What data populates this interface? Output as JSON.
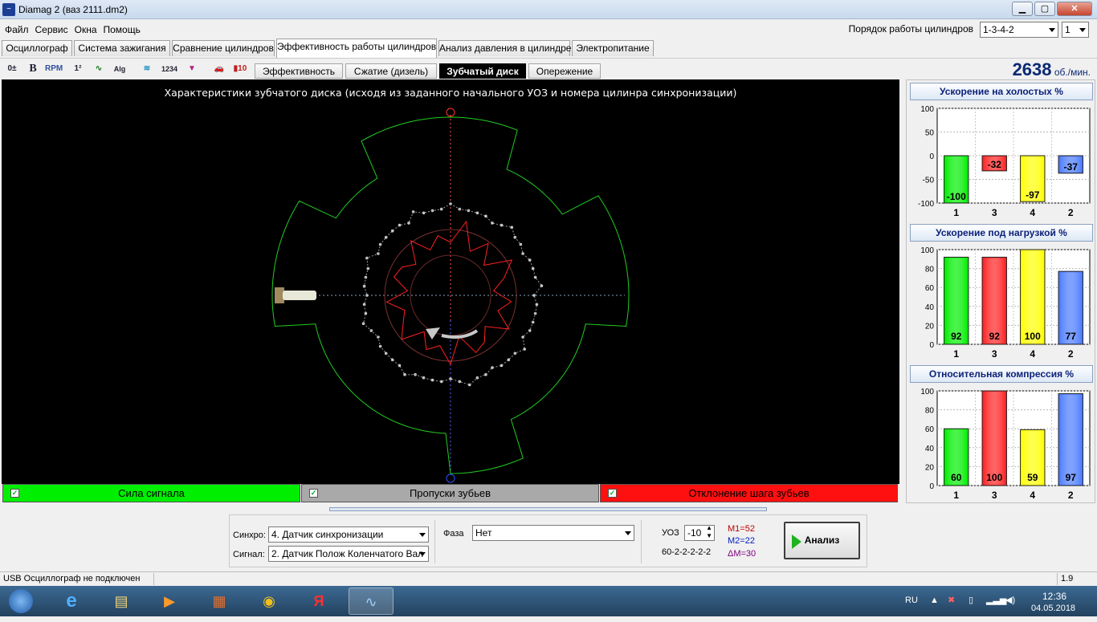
{
  "window": {
    "title": "Diamag 2 (ваз 2111.dm2)",
    "minimize": "▁",
    "maximize": "▢",
    "close": "✕"
  },
  "menu": [
    "Файл",
    "Сервис",
    "Окна",
    "Помощь"
  ],
  "cyl_order": {
    "label": "Порядок работы цилиндров",
    "value": "1-3-4-2",
    "cyl_number": "1"
  },
  "tabs": [
    "Осциллограф",
    "Система зажигания",
    "Сравнение цилиндров",
    "Эффективность работы цилиндров",
    "Анализ давления в цилиндре",
    "Электропитание"
  ],
  "active_tab": "Эффективность работы цилиндров",
  "toolbar_icons": [
    "zero-trim-icon",
    "bold-icon",
    "rpm-icon",
    "sort-icon",
    "trend-icon",
    "algorithm-icon",
    "sensor-icon",
    "counter-icon",
    "filter-icon",
    "car-icon",
    "bar-10-icon"
  ],
  "subtabs": [
    "Эффективность",
    "Сжатие (дизель)",
    "Зубчатый диск",
    "Опережение"
  ],
  "active_subtab": "Зубчатый диск",
  "rpm": {
    "value": "2638",
    "unit": "об./мин."
  },
  "plot": {
    "title": "Характеристики зубчатого диска (исходя из заданного начального УОЗ и номера цилинра синхронизации)"
  },
  "legend": [
    {
      "label": "Сила сигнала",
      "color": "#00ee00"
    },
    {
      "label": "Пропуски зубьев",
      "color": "#a9a9a9"
    },
    {
      "label": "Отклонение шага зубьев",
      "color": "#ff0000"
    }
  ],
  "charts_header": {
    "idle": "Ускорение на холостых %",
    "load": "Ускорение под нагрузкой %",
    "compression": "Относительная компрессия %"
  },
  "chart_data": [
    {
      "type": "bar",
      "title": "Ускорение на холостых %",
      "categories": [
        "1",
        "3",
        "4",
        "2"
      ],
      "values": [
        -100,
        -32,
        -97,
        -37
      ],
      "ylim": [
        -100,
        100
      ],
      "yticks": [
        "100",
        "50",
        "0",
        "-50",
        "-100"
      ],
      "colors": [
        "#00ee00",
        "#ff2020",
        "#ffff00",
        "#4a7aff"
      ]
    },
    {
      "type": "bar",
      "title": "Ускорение под нагрузкой %",
      "categories": [
        "1",
        "3",
        "4",
        "2"
      ],
      "values": [
        92,
        92,
        100,
        77
      ],
      "ylim": [
        0,
        100
      ],
      "yticks": [
        "100",
        "80",
        "60",
        "40",
        "20",
        "0"
      ],
      "colors": [
        "#00ee00",
        "#ff2020",
        "#ffff00",
        "#4a7aff"
      ]
    },
    {
      "type": "bar",
      "title": "Относительная компрессия %",
      "categories": [
        "1",
        "3",
        "4",
        "2"
      ],
      "values": [
        60,
        100,
        59,
        97
      ],
      "ylim": [
        0,
        100
      ],
      "yticks": [
        "100",
        "80",
        "60",
        "40",
        "20",
        "0"
      ],
      "colors": [
        "#00ee00",
        "#ff2020",
        "#ffff00",
        "#4a7aff"
      ]
    }
  ],
  "controls": {
    "sync_label": "Синхро:",
    "sync_value": "4.  Датчик синхронизации",
    "signal_label": "Сигнал:",
    "signal_value": "2.  Датчик Полож Коленчатого Вал",
    "phase_label": "Фаза",
    "phase_value": "Нет",
    "uoz_label": "УОЗ",
    "uoz_value": "-10",
    "disk_code": "60-2-2-2-2-2",
    "m1": "M1=52",
    "m2": "M2=22",
    "dm": "ΔM=30",
    "analyze_label": "Анализ"
  },
  "status": {
    "usb": "USB Осциллограф не подключен",
    "version": "1.9"
  },
  "taskbar": {
    "lang": "RU",
    "time": "12:36",
    "date": "04.05.2018"
  }
}
